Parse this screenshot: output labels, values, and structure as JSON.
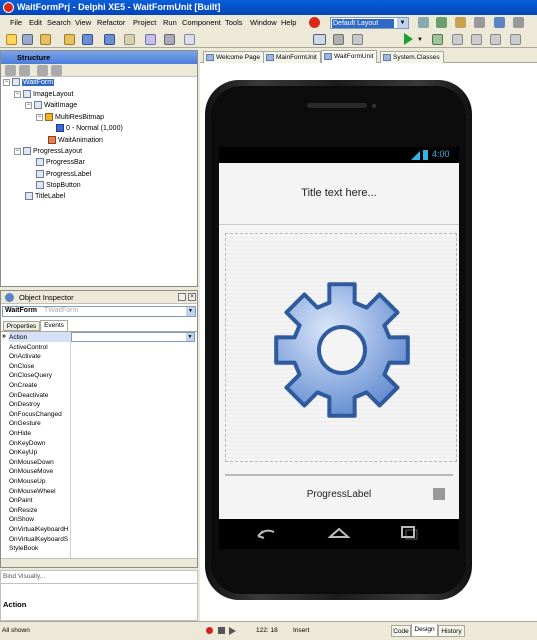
{
  "window": {
    "title": "WaitFormPrj - Delphi XE5 - WaitFormUnit [Built]"
  },
  "menu": [
    "File",
    "Edit",
    "Search",
    "View",
    "Refactor",
    "Project",
    "Run",
    "Component",
    "Tools",
    "Window",
    "Help"
  ],
  "layout_selector": {
    "value": "Default Layout"
  },
  "structure": {
    "title": "Structure",
    "nodes": [
      {
        "label": "WaitForm",
        "level": 0,
        "selected": true
      },
      {
        "label": "ImageLayout",
        "level": 1
      },
      {
        "label": "WaitImage",
        "level": 2
      },
      {
        "label": "MultiResBitmap",
        "level": 3
      },
      {
        "label": "0 - Normal (1,000)",
        "level": 4
      },
      {
        "label": "WaitAnimation",
        "level": 3
      },
      {
        "label": "ProgressLayout",
        "level": 1
      },
      {
        "label": "ProgressBar",
        "level": 2
      },
      {
        "label": "ProgressLabel",
        "level": 2
      },
      {
        "label": "StopButton",
        "level": 2
      },
      {
        "label": "TitleLabel",
        "level": 1
      }
    ]
  },
  "inspector": {
    "title": "Object Inspector",
    "object_name": "WaitForm",
    "object_type": "TWaitForm",
    "tabs": [
      "Properties",
      "Events"
    ],
    "active_tab": "Events",
    "events": [
      "Action",
      "ActiveControl",
      "OnActivate",
      "OnClose",
      "OnCloseQuery",
      "OnCreate",
      "OnDeactivate",
      "OnDestroy",
      "OnFocusChanged",
      "OnGesture",
      "OnHide",
      "OnKeyDown",
      "OnKeyUp",
      "OnMouseDown",
      "OnMouseMove",
      "OnMouseUp",
      "OnMouseWheel",
      "OnPaint",
      "OnResize",
      "OnShow",
      "OnVirtualKeyboardH",
      "OnVirtualKeyboardS",
      "StyleBook"
    ],
    "bind_visually": "Bind Visually...",
    "help_title": "Action",
    "filter_status": "All shown"
  },
  "doc_tabs": [
    "Welcome Page",
    "MainFormUnit",
    "WaitFormUnit",
    "System.Classes"
  ],
  "active_doc_tab": "WaitFormUnit",
  "device": {
    "clock": "4:00",
    "title_label": "Title text here...",
    "progress_label": "ProgressLabel"
  },
  "status": {
    "position": "122: 18",
    "mode": "Insert"
  },
  "view_tabs": [
    "Code",
    "Design",
    "History"
  ],
  "active_view_tab": "Design",
  "colors": {
    "title_bar": "#0a5fd8",
    "selection": "#316ac5",
    "gear_fill": "#7fa6df",
    "gear_stroke": "#2f5a9e"
  },
  "icons": [
    "delphi-logo-icon",
    "new-icon",
    "open-icon",
    "save-icon",
    "run-icon",
    "pause-icon",
    "device-icon",
    "gear-icon",
    "stop-icon",
    "back-nav-icon",
    "home-nav-icon",
    "recent-apps-icon",
    "battery-icon",
    "signal-icon"
  ]
}
